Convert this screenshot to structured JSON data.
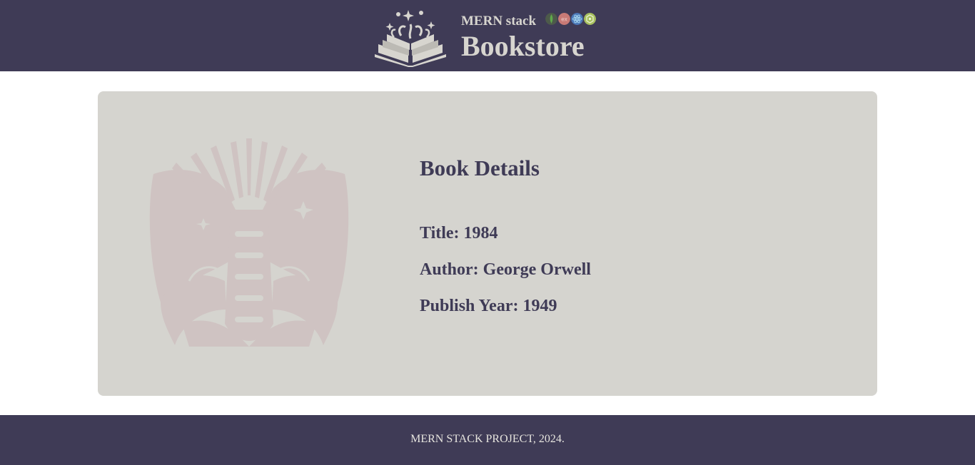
{
  "header": {
    "subtitle": "MERN stack",
    "title": "Bookstore",
    "logo_icon": "open-book-sparkles-icon",
    "tech_icons": [
      {
        "name": "mongodb-icon",
        "color": "#4d5a4a"
      },
      {
        "name": "express-icon",
        "color": "#c87a76"
      },
      {
        "name": "react-icon",
        "color": "#4b78b8"
      },
      {
        "name": "nodejs-icon",
        "color": "#a8c060"
      }
    ]
  },
  "book": {
    "heading": "Book Details",
    "title_line": "Title: 1984",
    "author_line": "Author: George Orwell",
    "year_line": "Publish Year: 1949",
    "art_icon": "book-hands-illustration-icon"
  },
  "footer": {
    "text": "MERN STACK PROJECT, 2024."
  },
  "colors": {
    "header_bg": "#3f3b56",
    "card_bg": "#d5d4cf",
    "text_dark": "#3f3b56",
    "text_light": "#d7d5cf",
    "art_tint": "#cfc3c2"
  }
}
